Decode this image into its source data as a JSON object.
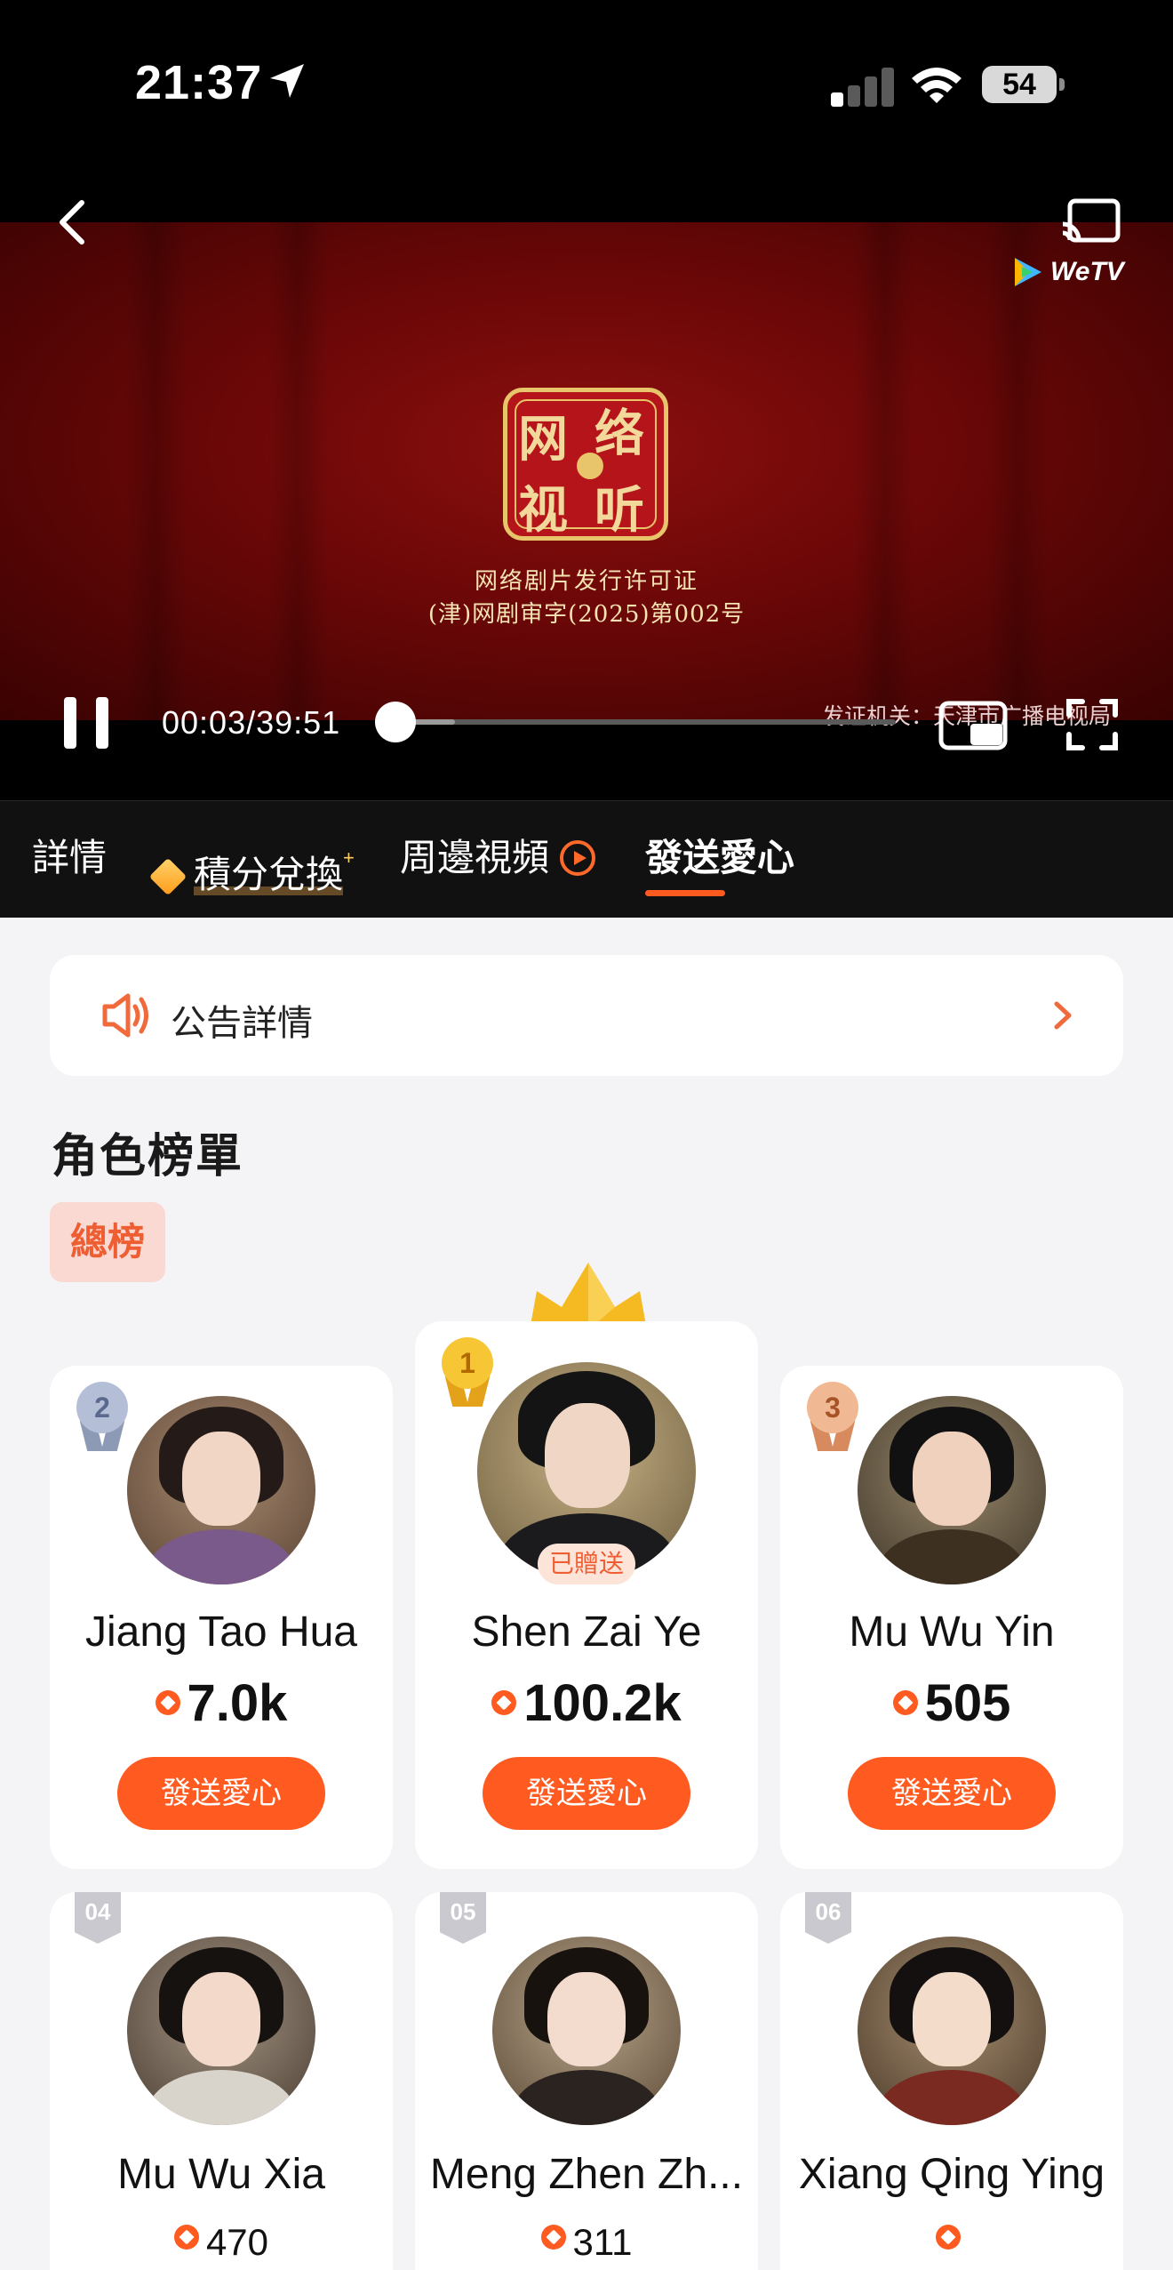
{
  "status_bar": {
    "time": "21:37",
    "battery": "54"
  },
  "player": {
    "brand": "WeTV",
    "seal_chars": [
      "网",
      "络",
      "视",
      "听"
    ],
    "license_line1": "网络剧片发行许可证",
    "license_line2": "(津)网剧审字(2025)第002号",
    "issuer": "发证机关：天津市广播电视局",
    "timecode": "00:03/39:51",
    "progress": {
      "played": 0.013,
      "buffered": 0.13
    }
  },
  "tabs": [
    {
      "label": "詳情"
    },
    {
      "label": "積分兌換",
      "sup": "+"
    },
    {
      "label": "周邊視頻"
    },
    {
      "label": "發送愛心",
      "active": true
    }
  ],
  "notice": {
    "label": "公告詳情"
  },
  "ranking": {
    "title": "角色榜單",
    "filter": "總榜",
    "send_label": "發送愛心",
    "gifted_label": "已贈送",
    "top": [
      {
        "rank": "2",
        "name": "Jiang Tao Hua",
        "score": "7.0k"
      },
      {
        "rank": "1",
        "name": "Shen Zai Ye",
        "score": "100.2k"
      },
      {
        "rank": "3",
        "name": "Mu Wu Yin",
        "score": "505"
      }
    ],
    "rest": [
      {
        "rank": "04",
        "name": "Mu Wu Xia",
        "score": "470"
      },
      {
        "rank": "05",
        "name": "Meng Zhen Zh...",
        "score": "311"
      },
      {
        "rank": "06",
        "name": "Xiang Qing Ying",
        "score": ""
      }
    ]
  },
  "colors": {
    "accent": "#ff5a1f",
    "chip_bg": "#f9d9d1",
    "gold": "#f5b921",
    "silver": "#9aa6c4",
    "bronze": "#e5a27c"
  }
}
